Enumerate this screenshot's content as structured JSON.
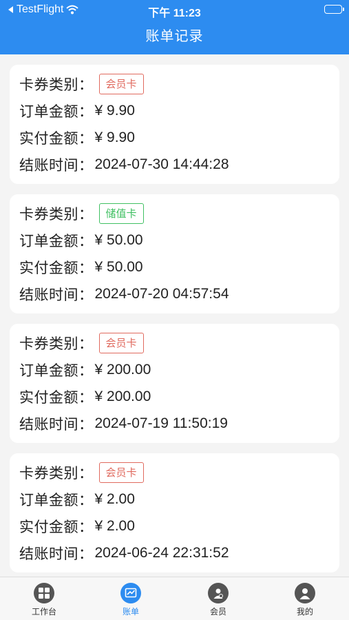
{
  "status_bar": {
    "back_app": "TestFlight",
    "time": "下午 11:23"
  },
  "header": {
    "title": "账单记录"
  },
  "labels": {
    "card_type": "卡券类别：",
    "order_amount": "订单金额：",
    "paid_amount": "实付金额：",
    "checkout_time": "结账时间："
  },
  "records": [
    {
      "type": "会员卡",
      "order": "¥ 9.90",
      "paid": "¥ 9.90",
      "time": "2024-07-30 14:44:28",
      "tag_color": "#e06a5e"
    },
    {
      "type": "储值卡",
      "order": "¥ 50.00",
      "paid": "¥ 50.00",
      "time": "2024-07-20 04:57:54",
      "tag_color": "#40c062"
    },
    {
      "type": "会员卡",
      "order": "¥ 200.00",
      "paid": "¥ 200.00",
      "time": "2024-07-19 11:50:19",
      "tag_color": "#e06a5e"
    },
    {
      "type": "会员卡",
      "order": "¥ 2.00",
      "paid": "¥ 2.00",
      "time": "2024-06-24 22:31:52",
      "tag_color": "#e06a5e"
    }
  ],
  "tabs": [
    {
      "label": "工作台",
      "icon": "grid-icon",
      "active": false
    },
    {
      "label": "账单",
      "icon": "chart-icon",
      "active": true
    },
    {
      "label": "会员",
      "icon": "member-icon",
      "active": false
    },
    {
      "label": "我的",
      "icon": "person-icon",
      "active": false
    }
  ],
  "colors": {
    "primary": "#2d8cf0",
    "background": "#f4f4f4"
  }
}
